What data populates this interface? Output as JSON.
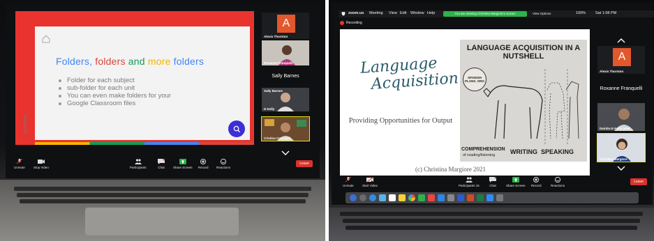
{
  "left_photo": {
    "slide": {
      "title_words": [
        {
          "text": "Folders,",
          "color": "#4285f4"
        },
        {
          "text": "folders",
          "color": "#db4437"
        },
        {
          "text": "and",
          "color": "#0f9d58"
        },
        {
          "text": "more",
          "color": "#f4b400"
        },
        {
          "text": "folders",
          "color": "#4285f4"
        }
      ],
      "bullets": [
        "Folder for each subject",
        "sub-folder for each unit",
        "You can even make folders for your",
        "Google Classroom files"
      ],
      "side_label": "ACTIVATED",
      "accent": "#e8332f"
    },
    "participants": [
      {
        "name": "Alexis Thornton",
        "initial": "A",
        "type": "avatar"
      },
      {
        "name": "Roxanne Franquelli",
        "type": "video"
      },
      {
        "name": "Sally Barnes",
        "type": "name-only"
      },
      {
        "name": "Sally Barnes",
        "type": "video-small"
      },
      {
        "name": "D Kelly",
        "type": "video"
      },
      {
        "name": "Cristina Concaziri",
        "type": "video",
        "active": true
      }
    ],
    "toolbar": {
      "unmute": "Unmute",
      "stop_video": "Stop Video",
      "participants": "Participants",
      "participant_count": "",
      "chat": "Chat",
      "share_screen": "Share Screen",
      "record": "Record",
      "reactions": "Reactions",
      "leave": "Leave"
    }
  },
  "right_photo": {
    "menubar": {
      "app": "zoom.us",
      "items": [
        "Meeting",
        "View",
        "Edit",
        "Window",
        "Help"
      ],
      "banner": "You are viewing Christina Margiore's screen",
      "view_options": "View Options",
      "battery": "100%",
      "clock": "Sat 1:08 PM"
    },
    "recording_label": "Recording",
    "slide": {
      "title_line1": "Language",
      "title_line2": "Acquisition",
      "subtitle": "Providing Opportunities for Output",
      "copyright": "(c) Christina Margiore 2021",
      "nutshell_title": "LANGUAGE ACQUISITION IN A NUTSHELL",
      "seal_text": "SPANISH PLANS. ORG",
      "comprehension": "COMPREHENSION",
      "comprehension_sub": "of reading/listening",
      "writing": "WRITING",
      "speaking": "SPEAKING"
    },
    "participants": [
      {
        "name": "Alexis Thornton",
        "initial": "A",
        "type": "avatar"
      },
      {
        "name": "Roxanne Franquelli",
        "type": "name-only"
      },
      {
        "name": "Deirdre E Kelly (she/...",
        "type": "video"
      },
      {
        "name": "Christina Margiore",
        "type": "video",
        "active": true
      }
    ],
    "toolbar": {
      "unmute": "Unmute",
      "start_video": "Start Video",
      "participants": "Participants",
      "participant_count": "16",
      "chat": "Chat",
      "share_screen": "Share Screen",
      "record": "Record",
      "reactions": "Reactions",
      "leave": "Leave"
    }
  }
}
